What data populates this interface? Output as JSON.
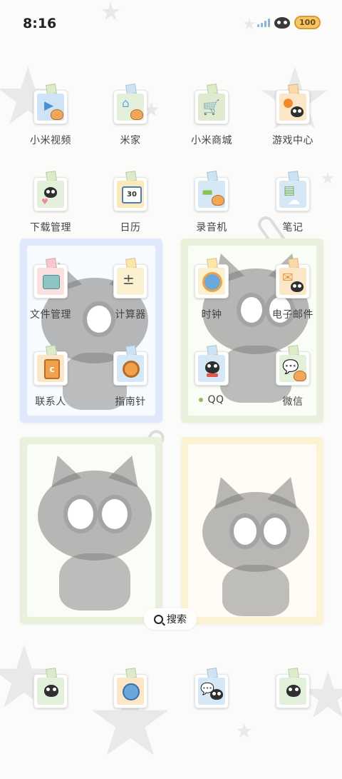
{
  "status_bar": {
    "time": "8:16",
    "battery": "100"
  },
  "pages": {
    "search_label": "搜索"
  },
  "colors": {
    "frame_blue": "#dfe9fb",
    "frame_green": "#e9f1dc",
    "frame_yellow": "#fbf3d4",
    "qq_dot": "#9bbb5a"
  },
  "apps": [
    {
      "label": "小米视频",
      "icon": "video-icon",
      "bg": "#cfe3f6"
    },
    {
      "label": "米家",
      "icon": "home-cup-icon",
      "bg": "#e3f0dc"
    },
    {
      "label": "小米商城",
      "icon": "shopping-cart-icon",
      "bg": "#dfead0"
    },
    {
      "label": "游戏中心",
      "icon": "game-center-icon",
      "bg": "#fbe6c8"
    },
    {
      "label": "下载管理",
      "icon": "download-cat-icon",
      "bg": "#e3f0dc"
    },
    {
      "label": "日历",
      "icon": "calendar-icon",
      "bg": "#fbe9b8",
      "day": "30"
    },
    {
      "label": "录音机",
      "icon": "recorder-icon",
      "bg": "#d6e8f5"
    },
    {
      "label": "笔记",
      "icon": "notes-icon",
      "bg": "#d6e8f5"
    },
    {
      "label": "文件管理",
      "icon": "folder-icon",
      "bg": "#fbe0e0"
    },
    {
      "label": "计算器",
      "icon": "calculator-icon",
      "bg": "#fbf1d0"
    },
    {
      "label": "时钟",
      "icon": "alarm-clock-icon",
      "bg": "#fbf1d0"
    },
    {
      "label": "电子邮件",
      "icon": "mail-icon",
      "bg": "#fbe6c8"
    },
    {
      "label": "联系人",
      "icon": "contacts-icon",
      "bg": "#fbe6c8"
    },
    {
      "label": "指南针",
      "icon": "compass-icon",
      "bg": "#d6e8f5"
    },
    {
      "label": "QQ",
      "icon": "qq-cat-icon",
      "bg": "#d6e8f5"
    },
    {
      "label": "微信",
      "icon": "wechat-icon",
      "bg": "#e3f0dc"
    }
  ],
  "dock": [
    {
      "icon": "phone-cat-icon",
      "bg": "#e3f0dc"
    },
    {
      "icon": "browser-globe-icon",
      "bg": "#fbe6c8"
    },
    {
      "icon": "messages-cat-icon",
      "bg": "#d6e8f5"
    },
    {
      "icon": "camera-cat-icon",
      "bg": "#e3f0dc"
    }
  ]
}
